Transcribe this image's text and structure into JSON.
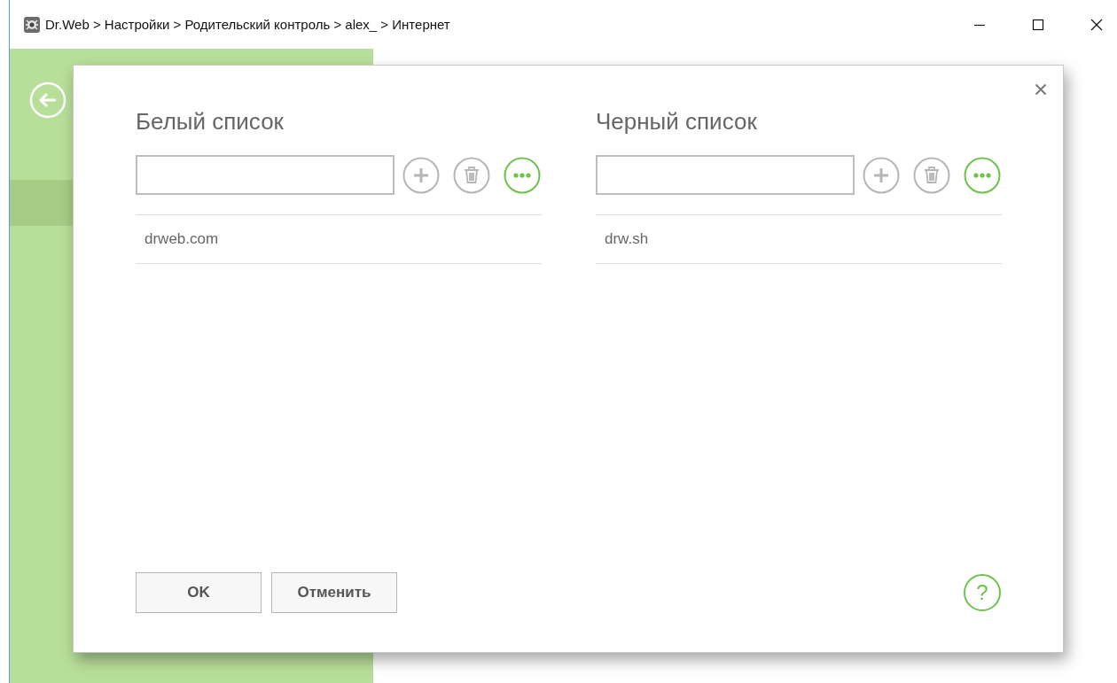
{
  "window": {
    "title": "Dr.Web > Настройки > Родительский контроль > alex_ > Интернет"
  },
  "dialog": {
    "lists": [
      {
        "heading": "Белый список",
        "tools": [
          {
            "kind": "add",
            "disabled": true
          },
          {
            "kind": "delete",
            "disabled": true
          },
          {
            "kind": "more",
            "disabled": false
          }
        ],
        "entries": [
          "drweb.com"
        ]
      },
      {
        "heading": "Черный список",
        "tools": [
          {
            "kind": "add",
            "disabled": true
          },
          {
            "kind": "delete",
            "disabled": true
          },
          {
            "kind": "more",
            "disabled": false
          }
        ],
        "entries": [
          "drw.sh"
        ]
      }
    ],
    "buttons": [
      "OK",
      "Отменить"
    ],
    "help": "?"
  }
}
